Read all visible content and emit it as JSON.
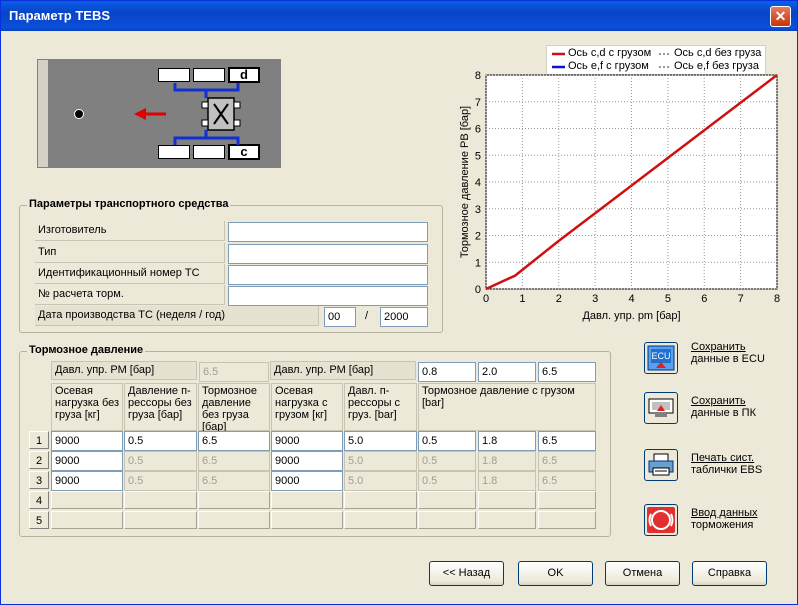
{
  "window": {
    "title": "Параметр TEBS",
    "close_label": "✕"
  },
  "diagram": {
    "label_d": "d",
    "label_c": "c"
  },
  "vehicle_params": {
    "title": "Параметры транспортного средства",
    "fields": [
      {
        "label": "Изготовитель",
        "value": ""
      },
      {
        "label": "Тип",
        "value": ""
      },
      {
        "label": "Идентификационный номер ТС",
        "value": ""
      },
      {
        "label": "№ расчета торм.",
        "value": ""
      }
    ],
    "date_label": "Дата производства ТС (неделя / год)",
    "date_week": "00",
    "date_separator": "/",
    "date_year": "2000"
  },
  "brake": {
    "title": "Тормозное давление",
    "pm_label_unloaded": "Давл. упр. РМ [бар]",
    "pm_unloaded_value": "6.5",
    "pm_label_loaded": "Давл. упр. РМ [бар]",
    "pm_loaded_values": [
      "0.8",
      "2.0",
      "6.5"
    ],
    "headers": [
      "Осевая нагрузка без груза [кг]",
      "Давление п-рессоры без груза [бар]",
      "Тормозное давление без груза [бар]",
      "Осевая нагрузка с грузом [кг]",
      "Давл. п-рессоры с груз. [bar]",
      "Тормозное давление с грузом [bar]"
    ],
    "rows": [
      {
        "num": "1",
        "cells": [
          "9000",
          "0.5",
          "6.5",
          "9000",
          "5.0",
          "0.5",
          "1.8",
          "6.5"
        ]
      },
      {
        "num": "2",
        "cells": [
          "9000",
          "0.5",
          "6.5",
          "9000",
          "5.0",
          "0.5",
          "1.8",
          "6.5"
        ]
      },
      {
        "num": "3",
        "cells": [
          "9000",
          "0.5",
          "6.5",
          "9000",
          "5.0",
          "0.5",
          "1.8",
          "6.5"
        ]
      },
      {
        "num": "4",
        "cells": []
      },
      {
        "num": "5",
        "cells": []
      }
    ]
  },
  "side_actions": [
    {
      "label1": "Сохранить",
      "label2": "данные в  ECU",
      "icon": "ecu-icon",
      "icon_text": "ECU"
    },
    {
      "label1": "Сохранить",
      "label2": "данные в ПК",
      "icon": "computer-icon"
    },
    {
      "label1": "Печать сист.",
      "label2": "таблички EBS",
      "icon": "printer-icon"
    },
    {
      "label1": "Ввод данных",
      "label2": "торможения",
      "icon": "brake-icon"
    }
  ],
  "buttons": {
    "back": "<< Назад",
    "ok": "OK",
    "cancel": "Отмена",
    "help": "Справка"
  },
  "chart_data": {
    "type": "line",
    "xlabel": "Давл. упр. pm [бар]",
    "ylabel": "Тормозное давление PB [бар]",
    "xlim": [
      0,
      8
    ],
    "ylim": [
      0,
      8
    ],
    "xticks": [
      "0",
      "1",
      "2",
      "3",
      "4",
      "5",
      "6",
      "7",
      "8"
    ],
    "yticks": [
      "0",
      "1",
      "2",
      "3",
      "4",
      "5",
      "6",
      "7",
      "8"
    ],
    "grid": true,
    "legend_position": "top",
    "legend": [
      "Ось c,d с грузом",
      "Ось c,d без груза",
      "Ось e,f с грузом",
      "Ось e,f без груза"
    ],
    "series": [
      {
        "name": "Ось c,d с грузом",
        "color": "#d01010",
        "style": "solid",
        "x": [
          0,
          0.8,
          2.0,
          8.0
        ],
        "y": [
          0,
          0.5,
          1.8,
          8.0
        ]
      },
      {
        "name": "Ось e,f с грузом",
        "color": "#1010d0",
        "style": "solid",
        "x": [],
        "y": []
      }
    ]
  },
  "colors": {
    "arrow": "#e00000",
    "axle_link": "#1030d0"
  }
}
